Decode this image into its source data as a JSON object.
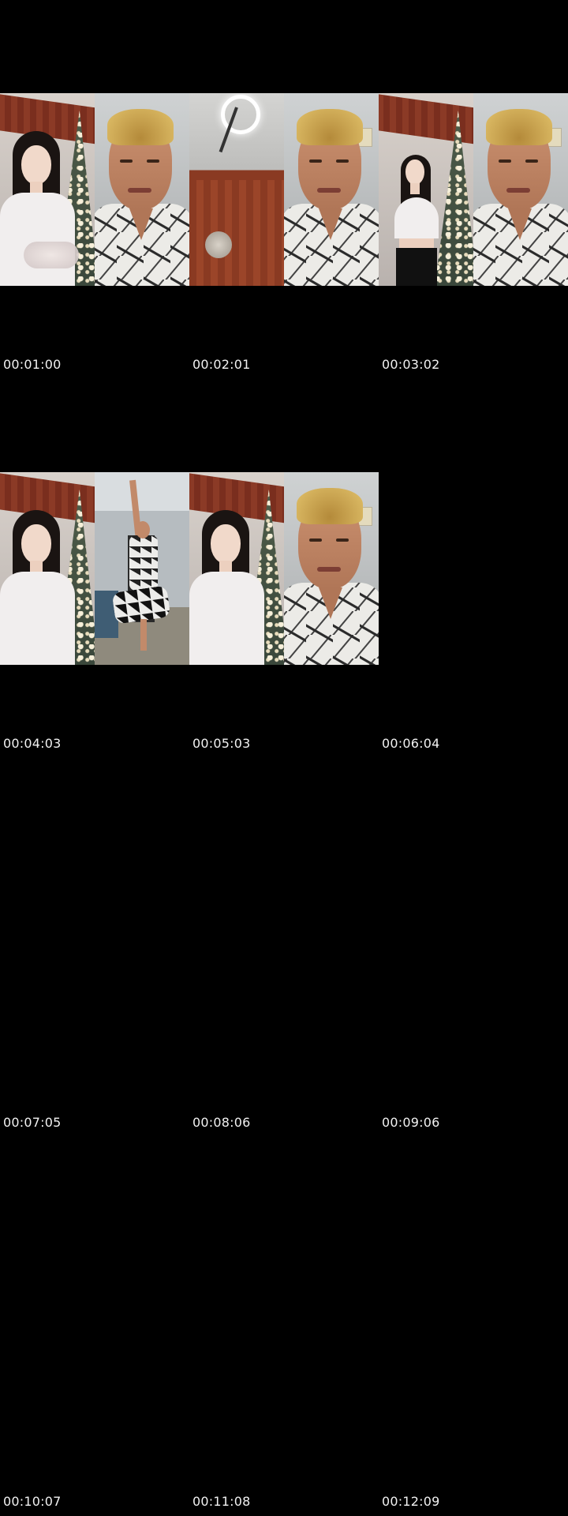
{
  "contact_sheet": {
    "rows": [
      {
        "frames": [
          {
            "scene": "girl-living-room"
          },
          {
            "scene": "man-close-up"
          },
          {
            "scene": "ceiling-light"
          },
          {
            "scene": "man-close-up"
          },
          {
            "scene": "girl-full-body"
          },
          {
            "scene": "man-close-up"
          }
        ],
        "timestamps": [
          "00:01:00",
          "00:02:01",
          "00:03:02"
        ]
      },
      {
        "frames": [
          {
            "scene": "girl-living-room"
          },
          {
            "scene": "man-dancing"
          },
          {
            "scene": "girl-living-room"
          },
          {
            "scene": "man-close-up"
          }
        ],
        "timestamps": [
          "00:04:03",
          "00:05:03",
          "00:06:04"
        ]
      },
      {
        "frames": [],
        "timestamps": [
          "00:07:05",
          "00:08:06",
          "00:09:06"
        ]
      },
      {
        "frames": [],
        "timestamps": [
          "00:10:07",
          "00:11:08",
          "00:12:09"
        ]
      }
    ]
  },
  "colors": {
    "background": "#000000",
    "timestamp_text": "#f2f2f2"
  }
}
